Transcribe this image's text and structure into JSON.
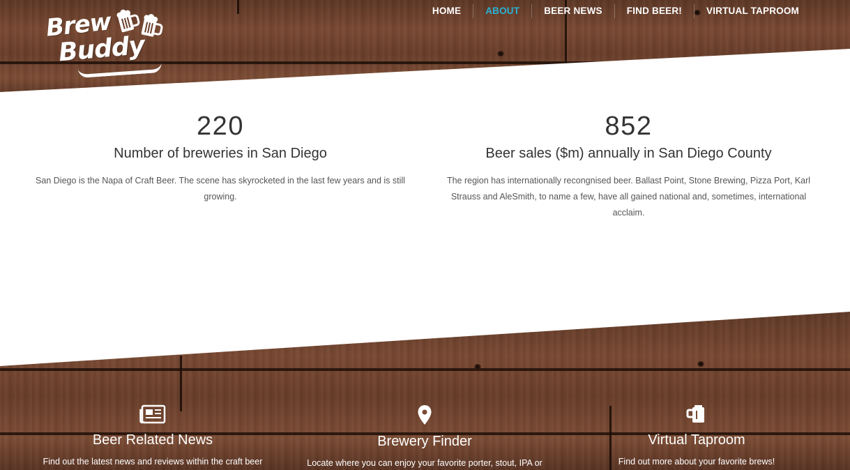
{
  "nav": {
    "items": [
      {
        "label": "HOME",
        "active": false
      },
      {
        "label": "ABOUT",
        "active": true
      },
      {
        "label": "BEER NEWS",
        "active": false
      },
      {
        "label": "FIND BEER!",
        "active": false
      },
      {
        "label": "VIRTUAL TAPROOM",
        "active": false
      }
    ],
    "active_color": "#2bb3d6"
  },
  "logo": {
    "line1": "Brew",
    "line2": "Buddy",
    "icon": "beer-mugs-icon"
  },
  "stats": [
    {
      "number": "220",
      "label": "Number of breweries in San Diego",
      "description": "San Diego is the Napa of Craft Beer. The scene has skyrocketed in the last few years and is still growing."
    },
    {
      "number": "852",
      "label": "Beer sales ($m) annually in San Diego County",
      "description": "The region has internationally recongnised beer. Ballast Point, Stone Brewing, Pizza Port, Karl Strauss and AleSmith, to name a few, have all gained national and, sometimes, international acclaim."
    }
  ],
  "features": [
    {
      "icon": "newspaper-icon",
      "title": "Beer Related News",
      "description": "Find out the latest news and reviews within the craft beer"
    },
    {
      "icon": "map-pin-icon",
      "title": "Brewery Finder",
      "description": "Locate where you can enjoy your favorite porter, stout, IPA or"
    },
    {
      "icon": "beer-mug-icon",
      "title": "Virtual Taproom",
      "description": "Find out more about your favorite brews!"
    }
  ],
  "colors": {
    "text_dark": "#333333",
    "text_body": "#555555",
    "wood": "#6a3f2b"
  }
}
